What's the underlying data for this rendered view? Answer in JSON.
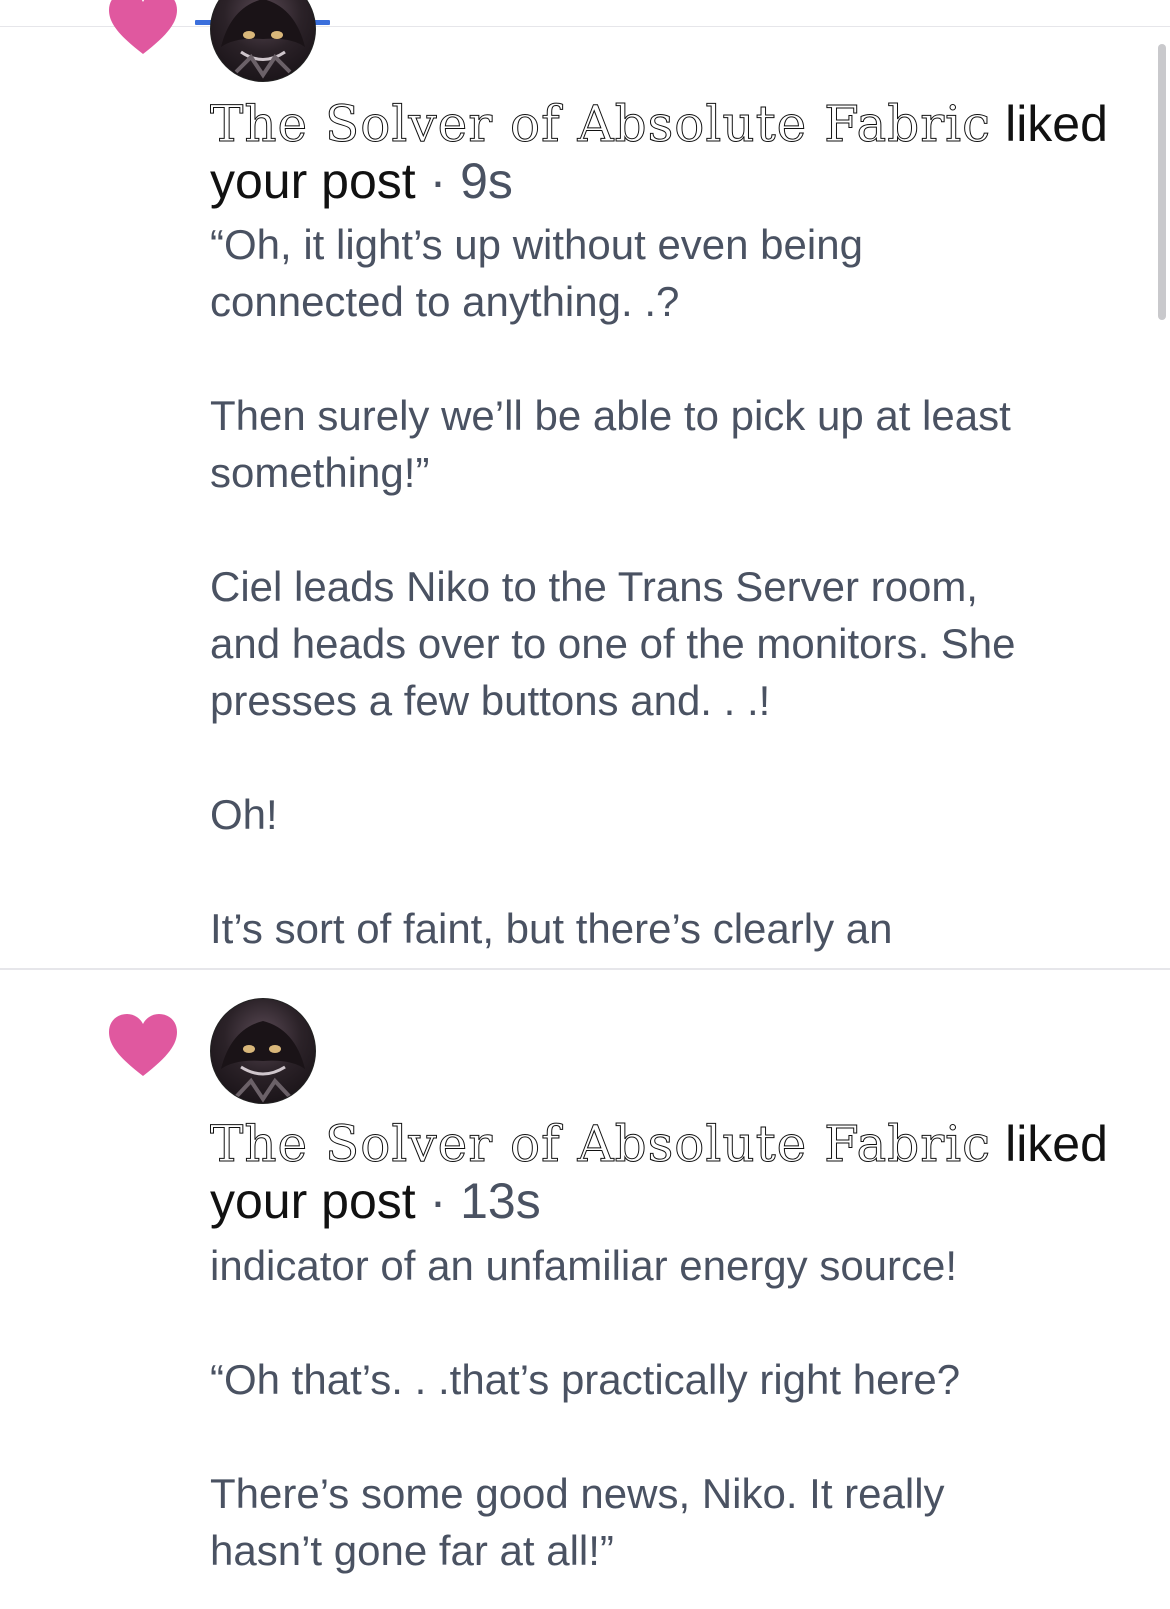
{
  "notifications": [
    {
      "author": "The Solver of Absolute Fabric",
      "action": " liked",
      "action_line2": "your post",
      "separator": " · ",
      "time": "9s",
      "body": "“Oh, it light’s up without even being\nconnected to anything. .?\n\nThen surely we’ll be able to pick up at least\nsomething!”\n\nCiel leads Niko to the Trans Server room,\nand heads over to one of the monitors. She\npresses a few buttons and. . .!\n\nOh!\n\nIt’s sort of faint, but there’s clearly an"
    },
    {
      "author": "The Solver of Absolute Fabric",
      "action": " liked",
      "action_line2": "your post",
      "separator": " · ",
      "time": "13s",
      "body": "indicator of an unfamiliar energy source!\n\n“Oh that’s. . .that’s practically right here?\n\nThere’s some good news, Niko. It really\nhasn’t gone far at all!”"
    }
  ],
  "colors": {
    "heart": "#e0589f",
    "tab_indicator": "#3b6fdc",
    "body_text": "#4a5262"
  },
  "icons": {
    "like": "heart-icon",
    "avatar": "user-avatar"
  }
}
